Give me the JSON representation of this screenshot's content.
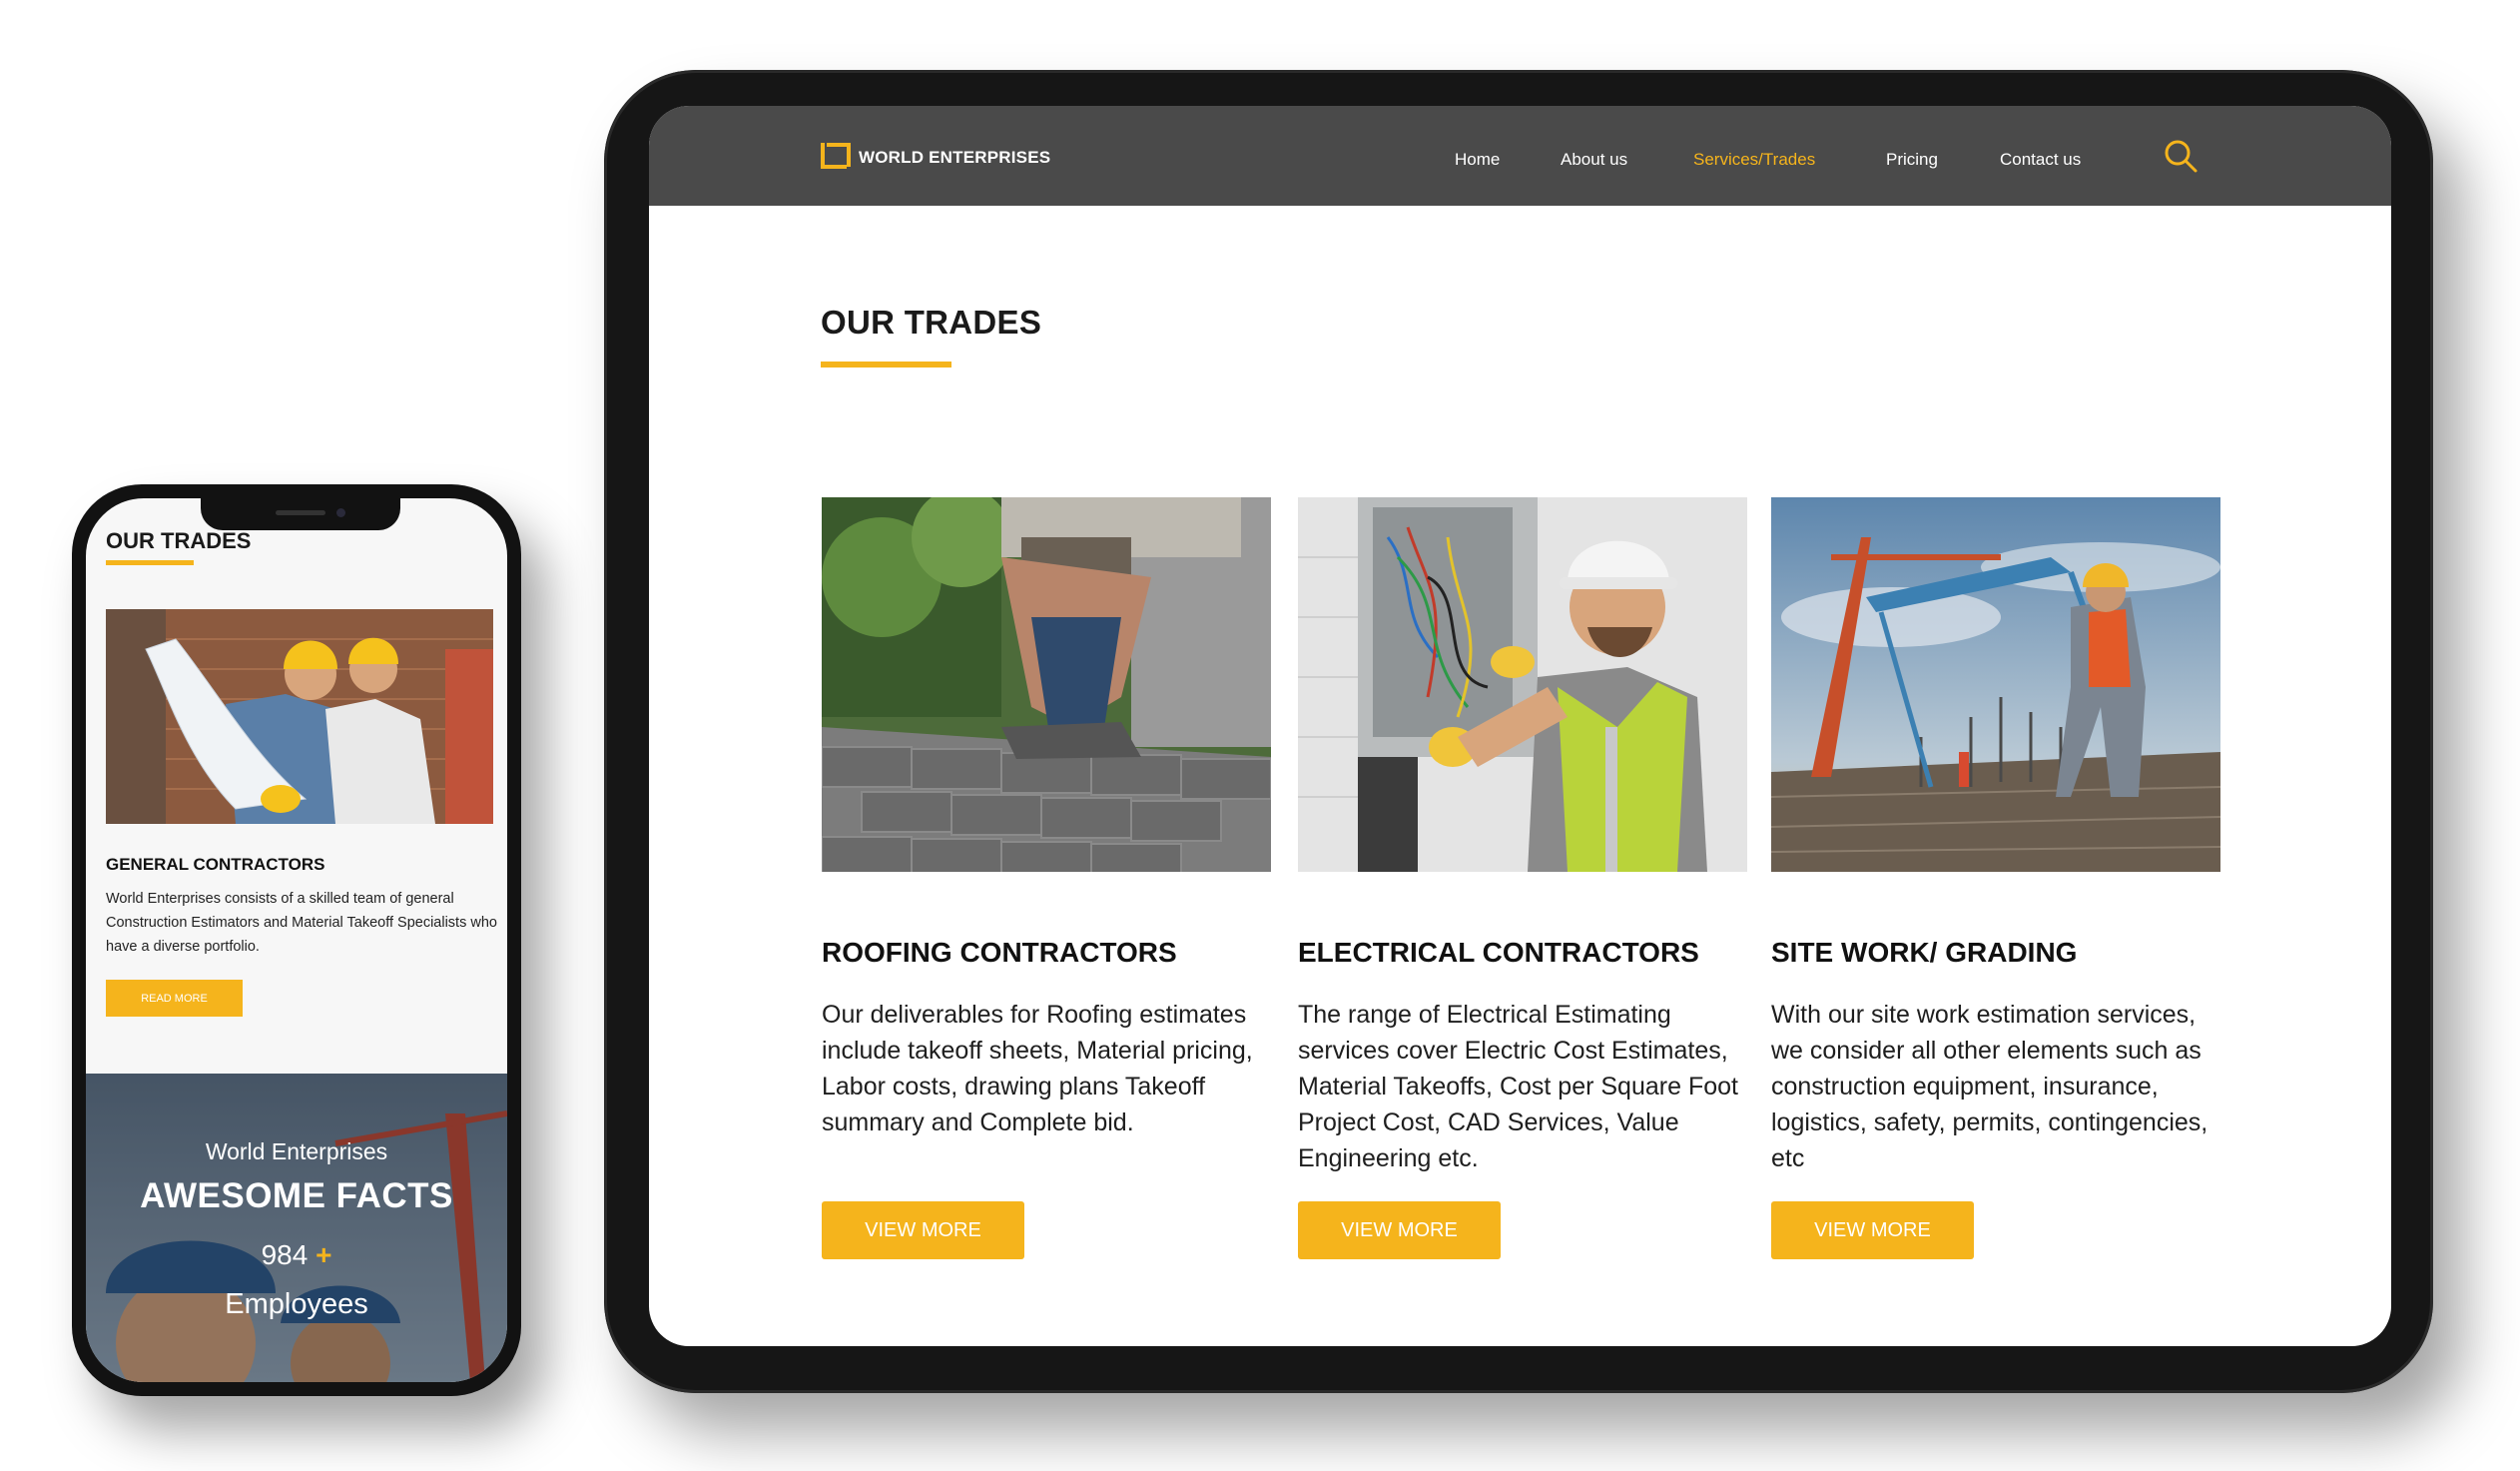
{
  "brand": {
    "name": "WORLD ENTERPRISES",
    "accent": "#f5b41c",
    "nav_bg": "#4a4a4a"
  },
  "nav": {
    "items": [
      {
        "label": "Home"
      },
      {
        "label": "About us"
      },
      {
        "label": "Services/Trades"
      },
      {
        "label": "Pricing"
      },
      {
        "label": "Contact us"
      }
    ],
    "active": "Services/Trades",
    "search_icon": "search-icon"
  },
  "tablet": {
    "section_title": "OUR TRADES",
    "cards": [
      {
        "title": "ROOFING CONTRACTORS",
        "text": "Our deliverables for Roofing estimates include takeoff sheets, Material pricing, Labor costs, drawing plans Takeoff summary and Complete bid.",
        "button": "VIEW MORE"
      },
      {
        "title": "ELECTRICAL CONTRACTORS",
        "text": "The range of Electrical Estimating services cover Electric Cost Estimates, Material Takeoffs, Cost per Square Foot Project Cost, CAD Services, Value Engineering etc.",
        "button": "VIEW MORE"
      },
      {
        "title": "SITE WORK/ GRADING",
        "text": "With our site work estimation services, we consider all other elements such as construction equipment, insurance, logistics, safety, permits, contingencies, etc",
        "button": "VIEW MORE"
      }
    ]
  },
  "phone": {
    "section_title": "OUR TRADES",
    "card": {
      "title": "GENERAL CONTRACTORS",
      "text": "World Enterprises consists of a skilled team of general Construction Estimators and Material Takeoff Specialists who have a diverse portfolio.",
      "button": "READ MORE"
    },
    "facts": {
      "subtitle": "World Enterprises",
      "title": "AWESOME FACTS",
      "number": "984",
      "plus": "+",
      "label": "Employees"
    }
  }
}
